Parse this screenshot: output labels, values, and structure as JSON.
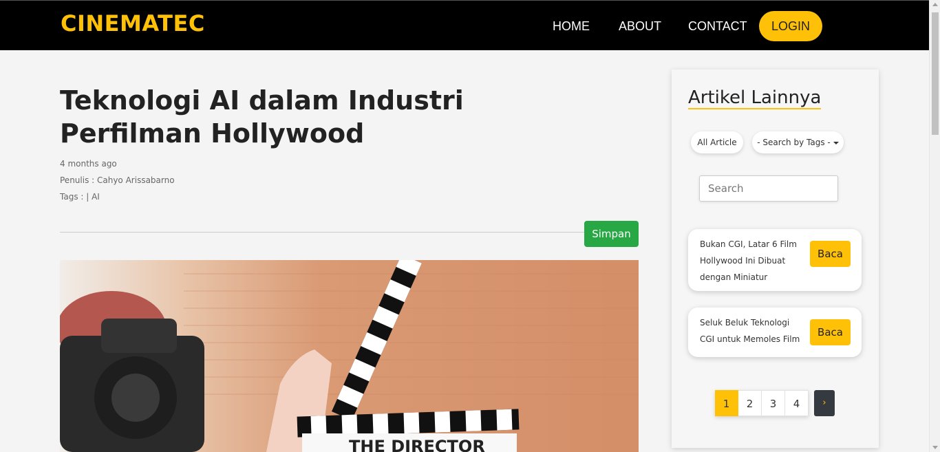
{
  "navbar": {
    "brand": "CINEMATEC",
    "links": [
      "HOME",
      "ABOUT",
      "CONTACT"
    ],
    "login_label": "LOGIN",
    "accent_color": "#ffc107"
  },
  "article": {
    "title": "Teknologi AI dalam Industri Perfilman Hollywood",
    "date": "4 months ago",
    "author": "Penulis : Cahyo Arissabarno",
    "tags": "Tags : | AI",
    "save_label": "Simpan",
    "image_text": "THE DIRECTOR"
  },
  "sidebar": {
    "title": "Artikel Lainnya",
    "filter_all": "All Article",
    "filter_tags": "- Search by Tags -",
    "search_placeholder": "Search",
    "articles": [
      {
        "title": "Bukan CGI, Latar 6 Film Hollywood Ini Dibuat dengan Miniatur",
        "button": "Baca"
      },
      {
        "title": "Seluk Beluk Teknologi CGI untuk Memoles Film",
        "button": "Baca"
      }
    ],
    "pages": [
      "1",
      "2",
      "3",
      "4"
    ],
    "active_page": "1",
    "next_label": "›"
  }
}
